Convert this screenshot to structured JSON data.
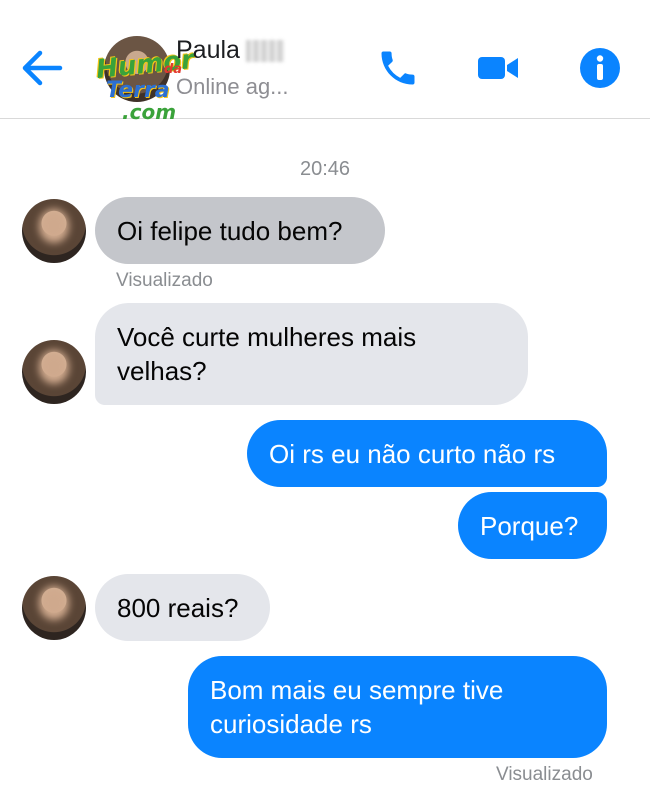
{
  "header": {
    "contact_name": "Paula",
    "status": "Online ag...",
    "icons": {
      "back": "back-arrow-icon",
      "phone": "phone-icon",
      "video": "video-camera-icon",
      "info": "info-icon"
    },
    "watermark": {
      "line1": "Humor",
      "line2": "da",
      "line3": "Terra",
      "line4": ".com"
    }
  },
  "conversation": {
    "timestamp": "20:46",
    "messages": [
      {
        "sender": "contact",
        "text": "Oi felipe tudo bem?",
        "receipt": "Visualizado"
      },
      {
        "sender": "contact",
        "text": "Você curte mulheres mais velhas?"
      },
      {
        "sender": "me",
        "text": "Oi rs eu não curto não rs"
      },
      {
        "sender": "me",
        "text": "Porque?"
      },
      {
        "sender": "contact",
        "text": "800 reais?"
      },
      {
        "sender": "me",
        "text": "Bom mais eu sempre tive curiosidade rs",
        "receipt": "Visualizado"
      }
    ]
  },
  "colors": {
    "accent": "#0a84ff",
    "incoming_bubble": "#e4e6eb",
    "meta_text": "#8a8d91"
  }
}
